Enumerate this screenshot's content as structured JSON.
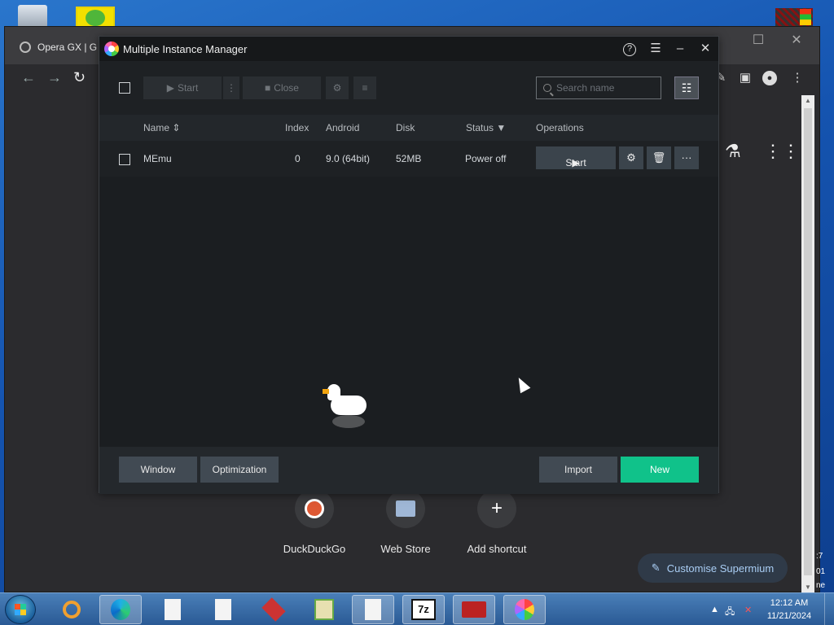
{
  "browser": {
    "tab_title": "Opera GX | G",
    "shortcuts": [
      {
        "label": "DuckDuckGo",
        "icon": "duckduckgo-icon"
      },
      {
        "label": "Web Store",
        "icon": "web-store-icon"
      },
      {
        "label": "Add shortcut",
        "icon": "plus-icon"
      }
    ],
    "customise_label": "Customise Supermium",
    "edge_text": [
      ":7",
      "01",
      "ne"
    ]
  },
  "mim": {
    "title": "Multiple Instance Manager",
    "toolbar": {
      "start_label": "Start",
      "close_label": "Close",
      "search_placeholder": "Search name"
    },
    "columns": {
      "name": "Name",
      "index": "Index",
      "android": "Android",
      "disk": "Disk",
      "status": "Status",
      "operations": "Operations"
    },
    "rows": [
      {
        "name": "MEmu",
        "index": "0",
        "android": "9.0 (64bit)",
        "disk": "52MB",
        "status": "Power off",
        "start_label": "Start"
      }
    ],
    "footer": {
      "window_label": "Window",
      "optimization_label": "Optimization",
      "import_label": "Import",
      "new_label": "New"
    },
    "colors": {
      "accent": "#10c28a",
      "button": "#414a53"
    }
  },
  "taskbar": {
    "time": "12:12 AM",
    "date": "11/21/2024",
    "items": [
      "search-app",
      "edge",
      "document",
      "document",
      "toolbox",
      "notepad-plus",
      "document",
      "7zip",
      "toolbox-red",
      "memu"
    ]
  }
}
